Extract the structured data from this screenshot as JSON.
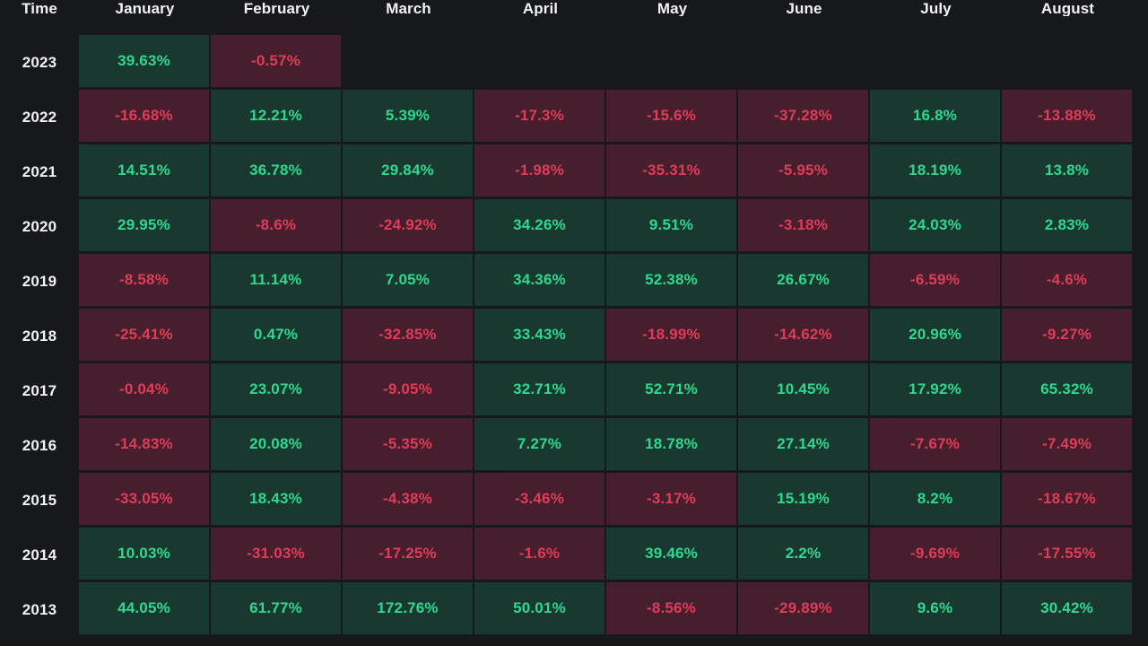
{
  "table": {
    "time_column_header": "Time",
    "month_headers": [
      "January",
      "February",
      "March",
      "April",
      "May",
      "June",
      "July",
      "August"
    ],
    "years": [
      "2023",
      "2022",
      "2021",
      "2020",
      "2019",
      "2018",
      "2017",
      "2016",
      "2015",
      "2014",
      "2013"
    ],
    "rows": [
      {
        "year": "2023",
        "cells": [
          "39.63%",
          "-0.57%",
          "",
          "",
          "",
          "",
          "",
          ""
        ]
      },
      {
        "year": "2022",
        "cells": [
          "-16.68%",
          "12.21%",
          "5.39%",
          "-17.3%",
          "-15.6%",
          "-37.28%",
          "16.8%",
          "-13.88%"
        ]
      },
      {
        "year": "2021",
        "cells": [
          "14.51%",
          "36.78%",
          "29.84%",
          "-1.98%",
          "-35.31%",
          "-5.95%",
          "18.19%",
          "13.8%"
        ]
      },
      {
        "year": "2020",
        "cells": [
          "29.95%",
          "-8.6%",
          "-24.92%",
          "34.26%",
          "9.51%",
          "-3.18%",
          "24.03%",
          "2.83%"
        ]
      },
      {
        "year": "2019",
        "cells": [
          "-8.58%",
          "11.14%",
          "7.05%",
          "34.36%",
          "52.38%",
          "26.67%",
          "-6.59%",
          "-4.6%"
        ]
      },
      {
        "year": "2018",
        "cells": [
          "-25.41%",
          "0.47%",
          "-32.85%",
          "33.43%",
          "-18.99%",
          "-14.62%",
          "20.96%",
          "-9.27%"
        ]
      },
      {
        "year": "2017",
        "cells": [
          "-0.04%",
          "23.07%",
          "-9.05%",
          "32.71%",
          "52.71%",
          "10.45%",
          "17.92%",
          "65.32%"
        ]
      },
      {
        "year": "2016",
        "cells": [
          "-14.83%",
          "20.08%",
          "-5.35%",
          "7.27%",
          "18.78%",
          "27.14%",
          "-7.67%",
          "-7.49%"
        ]
      },
      {
        "year": "2015",
        "cells": [
          "-33.05%",
          "18.43%",
          "-4.38%",
          "-3.46%",
          "-3.17%",
          "15.19%",
          "8.2%",
          "-18.67%"
        ]
      },
      {
        "year": "2014",
        "cells": [
          "10.03%",
          "-31.03%",
          "-17.25%",
          "-1.6%",
          "39.46%",
          "2.2%",
          "-9.69%",
          "-17.55%"
        ]
      },
      {
        "year": "2013",
        "cells": [
          "44.05%",
          "61.77%",
          "172.76%",
          "50.01%",
          "-8.56%",
          "-29.89%",
          "9.6%",
          "30.42%"
        ]
      }
    ]
  },
  "colors": {
    "background": "#16181C",
    "positive_cell_bg": "#19382F",
    "positive_text": "#2DD98F",
    "negative_cell_bg": "#471E2D",
    "negative_text": "#E03B57",
    "header_text": "#F2F2F2"
  },
  "chart_data": {
    "type": "heatmap",
    "title": "",
    "xlabel": "",
    "ylabel": "Time",
    "x_categories": [
      "January",
      "February",
      "March",
      "April",
      "May",
      "June",
      "July",
      "August"
    ],
    "y_categories": [
      "2023",
      "2022",
      "2021",
      "2020",
      "2019",
      "2018",
      "2017",
      "2016",
      "2015",
      "2014",
      "2013"
    ],
    "unit": "percent",
    "grid": true,
    "legend": "none",
    "values": [
      [
        39.63,
        -0.57,
        null,
        null,
        null,
        null,
        null,
        null
      ],
      [
        -16.68,
        12.21,
        5.39,
        -17.3,
        -15.6,
        -37.28,
        16.8,
        -13.88
      ],
      [
        14.51,
        36.78,
        29.84,
        -1.98,
        -35.31,
        -5.95,
        18.19,
        13.8
      ],
      [
        29.95,
        -8.6,
        -24.92,
        34.26,
        9.51,
        -3.18,
        24.03,
        2.83
      ],
      [
        -8.58,
        11.14,
        7.05,
        34.36,
        52.38,
        26.67,
        -6.59,
        -4.6
      ],
      [
        -25.41,
        0.47,
        -32.85,
        33.43,
        -18.99,
        -14.62,
        20.96,
        -9.27
      ],
      [
        -0.04,
        23.07,
        -9.05,
        32.71,
        52.71,
        10.45,
        17.92,
        65.32
      ],
      [
        -14.83,
        20.08,
        -5.35,
        7.27,
        18.78,
        27.14,
        -7.67,
        -7.49
      ],
      [
        -33.05,
        18.43,
        -4.38,
        -3.46,
        -3.17,
        15.19,
        8.2,
        -18.67
      ],
      [
        10.03,
        -31.03,
        -17.25,
        -1.6,
        39.46,
        2.2,
        -9.69,
        -17.55
      ],
      [
        44.05,
        61.77,
        172.76,
        50.01,
        -8.56,
        -29.89,
        9.6,
        30.42
      ]
    ]
  }
}
